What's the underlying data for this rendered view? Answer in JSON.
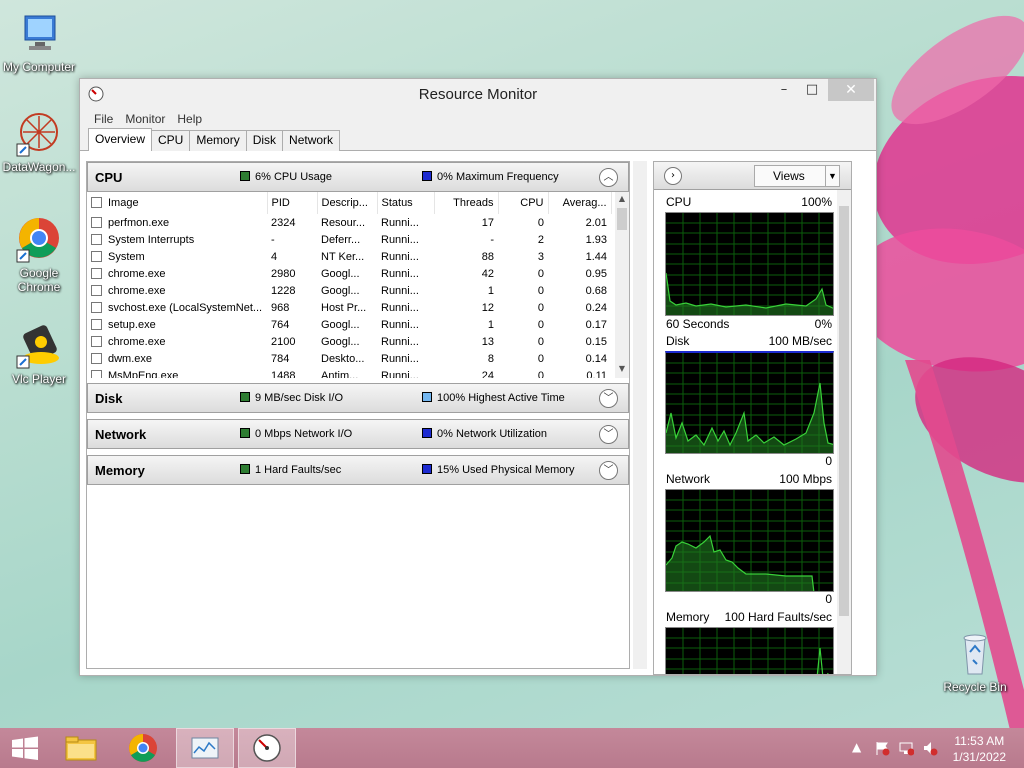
{
  "desktop": {
    "icons": [
      {
        "label": "My Computer"
      },
      {
        "label": "DataWagon..."
      },
      {
        "label": "Google Chrome"
      },
      {
        "label": "Vlc Player"
      },
      {
        "label": "Recycle Bin"
      }
    ]
  },
  "window": {
    "title": "Resource Monitor",
    "controls": {
      "minimize": "–",
      "maximize": "□",
      "close": "✕"
    },
    "menu": [
      "File",
      "Monitor",
      "Help"
    ],
    "tabs": [
      "Overview",
      "CPU",
      "Memory",
      "Disk",
      "Network"
    ],
    "active_tab": "Overview"
  },
  "cpu": {
    "name": "CPU",
    "usage": "6% CPU Usage",
    "frequency": "0% Maximum Frequency",
    "columns": [
      "Image",
      "PID",
      "Descrip...",
      "Status",
      "Threads",
      "CPU",
      "Averag..."
    ],
    "rows": [
      {
        "image": "perfmon.exe",
        "pid": "2324",
        "desc": "Resour...",
        "status": "Runni...",
        "threads": "17",
        "cpu": "0",
        "avg": "2.01"
      },
      {
        "image": "System Interrupts",
        "pid": "-",
        "desc": "Deferr...",
        "status": "Runni...",
        "threads": "-",
        "cpu": "2",
        "avg": "1.93"
      },
      {
        "image": "System",
        "pid": "4",
        "desc": "NT Ker...",
        "status": "Runni...",
        "threads": "88",
        "cpu": "3",
        "avg": "1.44"
      },
      {
        "image": "chrome.exe",
        "pid": "2980",
        "desc": "Googl...",
        "status": "Runni...",
        "threads": "42",
        "cpu": "0",
        "avg": "0.95"
      },
      {
        "image": "chrome.exe",
        "pid": "1228",
        "desc": "Googl...",
        "status": "Runni...",
        "threads": "1",
        "cpu": "0",
        "avg": "0.68"
      },
      {
        "image": "svchost.exe (LocalSystemNet...",
        "pid": "968",
        "desc": "Host Pr...",
        "status": "Runni...",
        "threads": "12",
        "cpu": "0",
        "avg": "0.24"
      },
      {
        "image": "setup.exe",
        "pid": "764",
        "desc": "Googl...",
        "status": "Runni...",
        "threads": "1",
        "cpu": "0",
        "avg": "0.17"
      },
      {
        "image": "chrome.exe",
        "pid": "2100",
        "desc": "Googl...",
        "status": "Runni...",
        "threads": "13",
        "cpu": "0",
        "avg": "0.15"
      },
      {
        "image": "dwm.exe",
        "pid": "784",
        "desc": "Deskto...",
        "status": "Runni...",
        "threads": "8",
        "cpu": "0",
        "avg": "0.14"
      },
      {
        "image": "MsMpEng.exe",
        "pid": "1488",
        "desc": "Antim...",
        "status": "Runni...",
        "threads": "24",
        "cpu": "0",
        "avg": "0.11"
      }
    ]
  },
  "disk": {
    "name": "Disk",
    "io": "9 MB/sec Disk I/O",
    "active": "100% Highest Active Time"
  },
  "network": {
    "name": "Network",
    "io": "0 Mbps Network I/O",
    "util": "0% Network Utilization"
  },
  "memory": {
    "name": "Memory",
    "faults": "1 Hard Faults/sec",
    "used": "15% Used Physical Memory"
  },
  "graphs": {
    "views_label": "Views",
    "cpu": {
      "title": "CPU",
      "max": "100%",
      "footer_left": "60 Seconds",
      "footer_right": "0%"
    },
    "disk": {
      "title": "Disk",
      "max": "100 MB/sec",
      "footer_right": "0"
    },
    "network": {
      "title": "Network",
      "max": "100 Mbps",
      "footer_right": "0"
    },
    "memory": {
      "title": "Memory",
      "max": "100 Hard Faults/sec"
    }
  },
  "taskbar": {
    "time": "11:53 AM",
    "date": "1/31/2022"
  },
  "colors": {
    "indicator_green": "#2e7d32",
    "indicator_blue": "#1d2bd1",
    "indicator_lightblue": "#74b7f0",
    "graph_line": "#39d139"
  }
}
